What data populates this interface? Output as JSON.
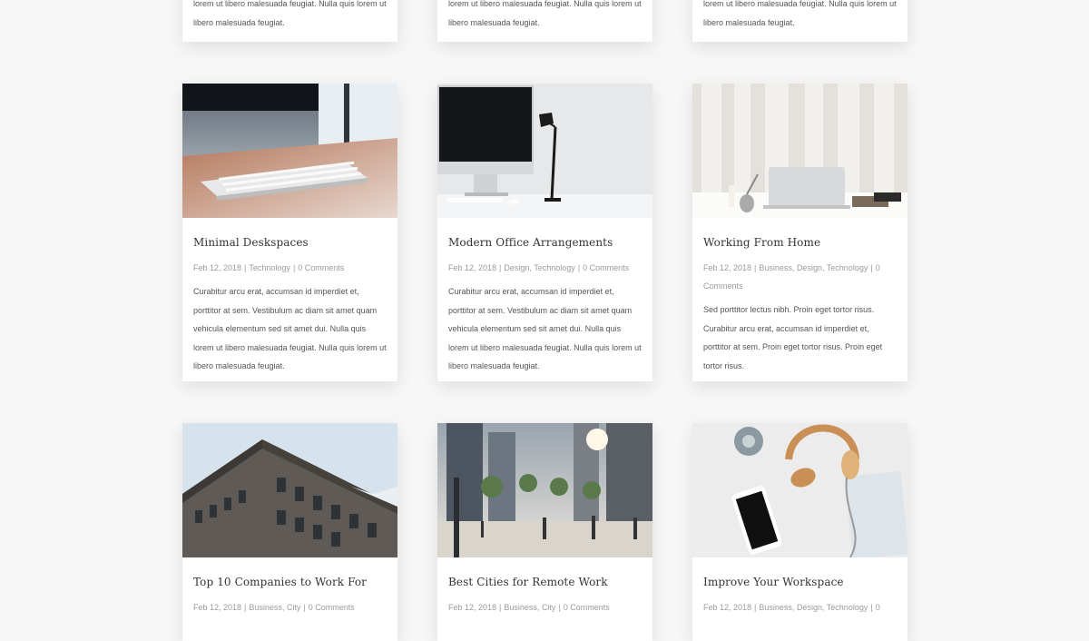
{
  "top_row": [
    {
      "excerpt": "lorem ut libero malesuada feugiat. Nulla quis lorem ut libero malesuada feugiat."
    },
    {
      "excerpt": "lorem ut libero malesuada feugiat. Nulla quis lorem ut libero malesuada feugiat."
    },
    {
      "excerpt": "lorem ut libero malesuada feugiat. Nulla quis lorem ut libero malesuada feugiat."
    }
  ],
  "posts": [
    {
      "title": "Minimal Deskspaces",
      "date": "Feb 12, 2018",
      "categories": [
        "Technology"
      ],
      "comments": "0 Comments",
      "excerpt": "Curabitur arcu erat, accumsan id imperdiet et, porttitor at sem. Vestibulum ac diam sit amet quam vehicula elementum sed sit amet dui. Nulla quis lorem ut libero malesuada feugiat. Nulla quis lorem ut libero malesuada feugiat."
    },
    {
      "title": "Modern Office Arrangements",
      "date": "Feb 12, 2018",
      "categories": [
        "Design",
        "Technology"
      ],
      "comments": "0 Comments",
      "excerpt": "Curabitur arcu erat, accumsan id imperdiet et, porttitor at sem. Vestibulum ac diam sit amet quam vehicula elementum sed sit amet dui. Nulla quis lorem ut libero malesuada feugiat. Nulla quis lorem ut libero malesuada feugiat."
    },
    {
      "title": "Working From Home",
      "date": "Feb 12, 2018",
      "categories": [
        "Business",
        "Design",
        "Technology"
      ],
      "comments": "0 Comments",
      "excerpt": "Sed porttitor lectus nibh. Proin eget tortor risus. Curabitur arcu erat, accumsan id imperdiet et, porttitor at sem. Proin eget tortor risus. Proin eget tortor risus."
    },
    {
      "title": "Top 10 Companies to Work For",
      "date": "Feb 12, 2018",
      "categories": [
        "Business",
        "City"
      ],
      "comments": "0 Comments",
      "excerpt": ""
    },
    {
      "title": "Best Cities for Remote Work",
      "date": "Feb 12, 2018",
      "categories": [
        "Business",
        "City"
      ],
      "comments": "0 Comments",
      "excerpt": ""
    },
    {
      "title": "Improve Your Workspace",
      "date": "Feb 12, 2018",
      "categories": [
        "Business",
        "Design",
        "Technology"
      ],
      "comments": "0",
      "excerpt": ""
    }
  ],
  "colors": {
    "page_bg": "#f7f7f7",
    "card_bg": "#ffffff",
    "title": "#333333",
    "meta": "#9a9a9a",
    "excerpt": "#555555"
  },
  "icons": {
    "separator": "|"
  }
}
